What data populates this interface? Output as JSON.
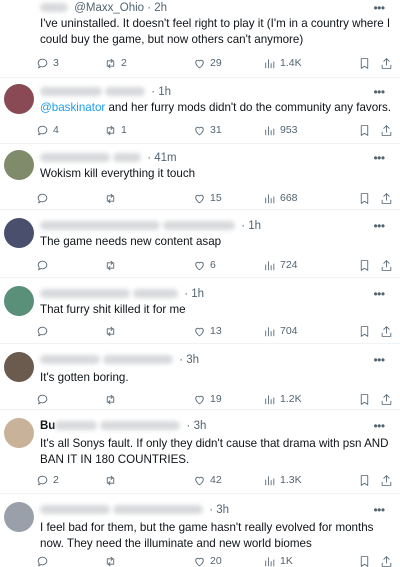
{
  "tweets": [
    {
      "name": "",
      "handle": "@Maxx_Ohio",
      "time": "2h",
      "text": "I've uninstalled. It doesn't feel right to play it (I'm in a country where I could buy the game, but now others can't anymore)",
      "replies": "3",
      "reposts": "2",
      "likes": "29",
      "views": "1.4K",
      "avatar_color": "#b9b9c2"
    },
    {
      "name": "",
      "handle": "",
      "time": "1h",
      "mention": "@baskinator",
      "text": " and her furry mods didn't do the community any favors.",
      "replies": "4",
      "reposts": "1",
      "likes": "31",
      "views": "953",
      "avatar_color": "#8a4a55"
    },
    {
      "name": "",
      "handle": "",
      "time": "41m",
      "text": "Wokism kill everything it touch",
      "replies": "",
      "reposts": "",
      "likes": "15",
      "views": "668",
      "avatar_color": "#7f8b6a"
    },
    {
      "name": "",
      "handle": "",
      "time": "1h",
      "text": "The game needs new content asap",
      "replies": "",
      "reposts": "",
      "likes": "6",
      "views": "724",
      "avatar_color": "#4a4f6e"
    },
    {
      "name": "",
      "handle": "",
      "time": "1h",
      "text": "That furry shit killed it for me",
      "replies": "",
      "reposts": "",
      "likes": "13",
      "views": "704",
      "avatar_color": "#5a8f7a"
    },
    {
      "name": "",
      "handle": "",
      "time": "3h",
      "text": "It's gotten boring.",
      "replies": "",
      "reposts": "",
      "likes": "19",
      "views": "1.2K",
      "avatar_color": "#6b5a4e"
    },
    {
      "name": "Bu",
      "handle": "",
      "time": "3h",
      "text": "It's all Sonys fault. If only they didn't cause that drama with psn AND BAN IT IN 180 COUNTRIES.",
      "replies": "2",
      "reposts": "",
      "likes": "42",
      "views": "1.3K",
      "avatar_color": "#c8b39a"
    },
    {
      "name": "",
      "handle": "",
      "time": "3h",
      "text": "I feel bad for them, but the game hasn't really evolved for months now. They need the illuminate and new world biomes",
      "replies": "",
      "reposts": "",
      "likes": "20",
      "views": "1K",
      "avatar_color": "#9aa0aa"
    }
  ]
}
